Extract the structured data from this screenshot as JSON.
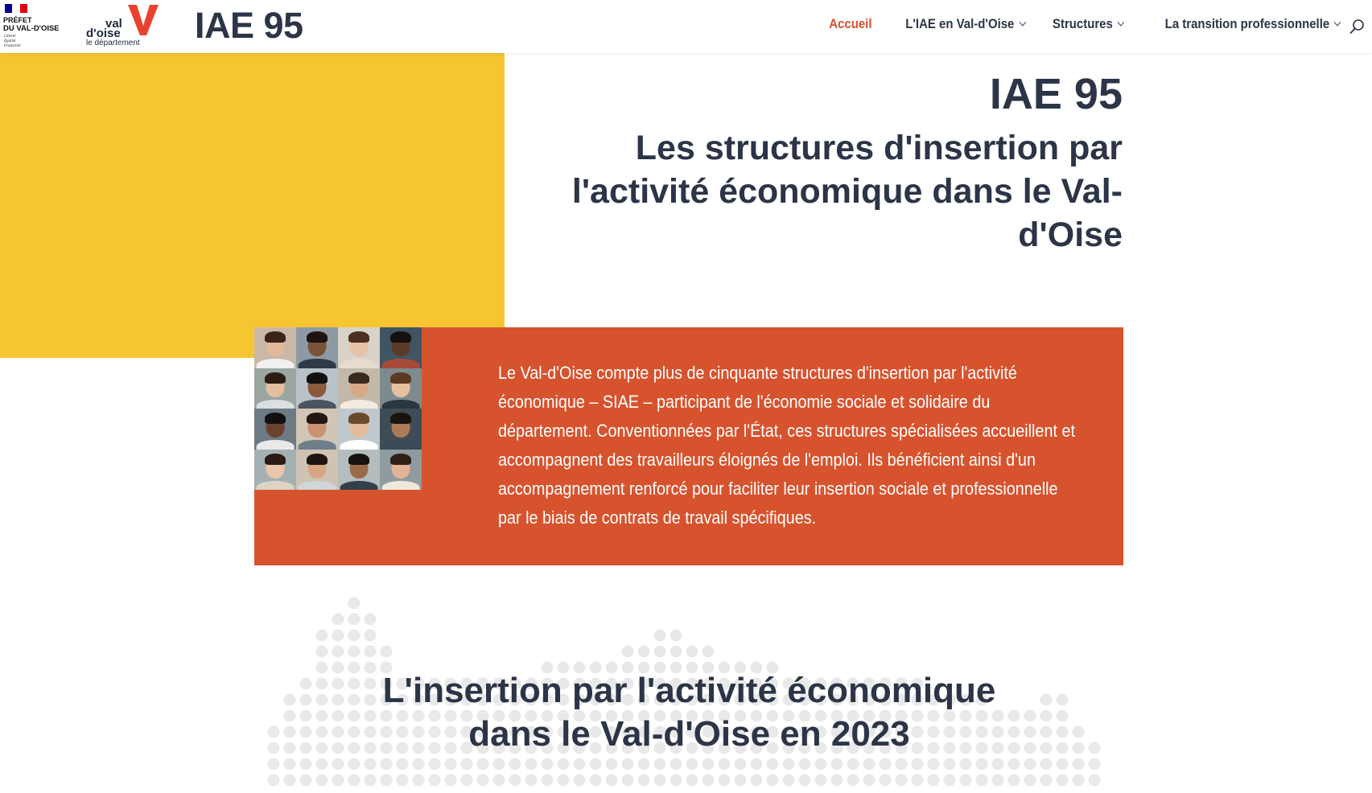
{
  "header": {
    "prefet_logo": {
      "line1": "PRÉFET",
      "line2": "DU VAL-D'OISE",
      "motto": [
        "Liberté",
        "Égalité",
        "Fraternité"
      ]
    },
    "vdo_logo": {
      "val": "val",
      "doise": "d'oise",
      "subtitle": "le département"
    },
    "site_title": "IAE 95",
    "nav": [
      {
        "label": "Accueil",
        "active": true,
        "has_dropdown": false
      },
      {
        "label": "L'IAE en Val-d'Oise",
        "active": false,
        "has_dropdown": true
      },
      {
        "label": "Structures",
        "active": false,
        "has_dropdown": true
      },
      {
        "label": "La transition professionnelle",
        "active": false,
        "has_dropdown": true
      }
    ],
    "search_icon": "search-icon"
  },
  "hero": {
    "title": "IAE 95",
    "subtitle": "Les structures d'insertion par l'activité économique dans le Val-d'Oise",
    "intro": "Le Val-d'Oise compte plus de cinquante structures d'insertion par l'activité économique – SIAE – participant de l'économie sociale et solidaire du département. Conventionnées par l'État, ces structures spécialisées accueillent et accompagnent des travailleurs éloignés de l'emploi. Ils bénéficient ainsi d'un accompagnement renforcé pour faciliter leur insertion sociale et professionnelle par le biais de contrats de travail spécifiques."
  },
  "section": {
    "title_line1": "L'insertion par l'activité économique",
    "title_line2": "dans le Val-d'Oise en 2023"
  },
  "colors": {
    "yellow": "#f7c531",
    "orange": "#d6532e",
    "navy": "#2b3547",
    "accent": "#d6502f",
    "dots": "#e9e9e9"
  }
}
